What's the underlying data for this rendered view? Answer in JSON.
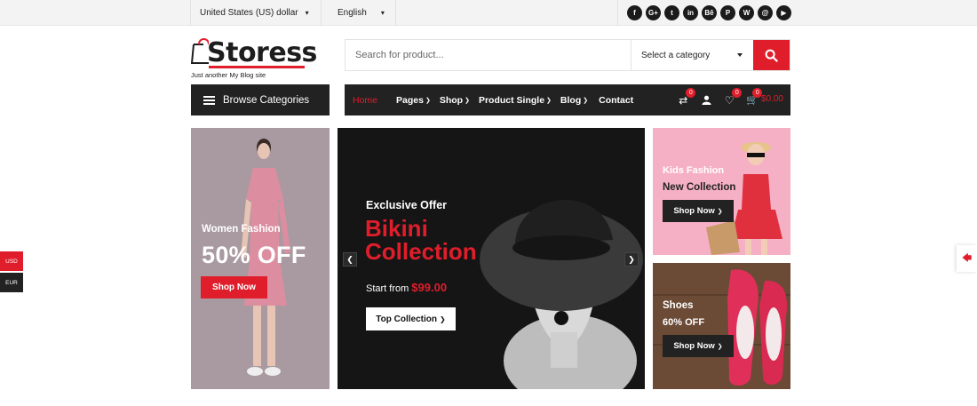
{
  "topbar": {
    "currency": "United States (US) dollar",
    "language": "English",
    "socials": [
      "f",
      "G+",
      "t",
      "in",
      "Bē",
      "P",
      "W",
      "@",
      "▶"
    ]
  },
  "logo": {
    "name": "Storess",
    "tagline": "Just another My Blog site"
  },
  "search": {
    "placeholder": "Search for product...",
    "category": "Select a category"
  },
  "browse": {
    "label": "Browse Categories"
  },
  "nav": {
    "home": "Home",
    "pages": "Pages",
    "shop": "Shop",
    "product_single": "Product Single",
    "blog": "Blog",
    "contact": "Contact"
  },
  "cart": {
    "compare_count": "0",
    "wishlist_count": "0",
    "cart_count": "0",
    "total": "$0.00"
  },
  "banners": {
    "women": {
      "subtitle": "Women Fashion",
      "headline": "50% OFF",
      "button": "Shop Now"
    },
    "main": {
      "offer": "Exclusive Offer",
      "title_line1": "Bikini",
      "title_line2": "Collection",
      "start_text": "Start from",
      "price": "$99.00",
      "button": "Top Collection"
    },
    "kids": {
      "label": "Kids Fashion",
      "title": "New Collection",
      "button": "Shop Now"
    },
    "shoes": {
      "label": "Shoes",
      "offer": "60% OFF",
      "button": "Shop Now"
    }
  },
  "currency_switch": {
    "usd": "USD",
    "eur": "EUR"
  },
  "colors": {
    "accent": "#e01e2b",
    "dark": "#222222"
  }
}
